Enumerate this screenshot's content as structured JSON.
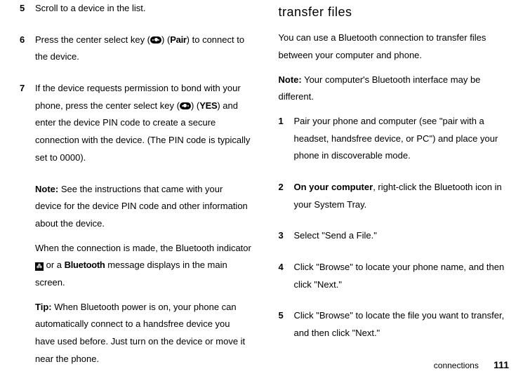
{
  "left": {
    "step5": {
      "num": "5",
      "text": "Scroll to a device in the list."
    },
    "step6": {
      "num": "6",
      "pre": "Press the center select key (",
      "key": "Pair",
      "post": ") to connect to the device."
    },
    "step7": {
      "num": "7",
      "p1a": "If the device requests permission to bond with your phone, press the center select key (",
      "p1key": "YES",
      "p1b": ") and enter the device PIN code to create a secure connection with the device. (The PIN code is typically set to 0000).",
      "noteLabel": "Note:",
      "noteText": " See the instructions that came with your device for the device PIN code and other information about the device.",
      "p2a": "When the connection is made, the Bluetooth indicator ",
      "p2b": " or a ",
      "p2word": "Bluetooth",
      "p2c": " message displays in the main screen.",
      "tipLabel": "Tip:",
      "tipText": " When Bluetooth power is on, your phone can automatically connect to a handsfree device you have used before. Just turn on the device or move it near the phone."
    }
  },
  "right": {
    "heading": "transfer files",
    "intro": "You can use a Bluetooth connection to transfer files between your computer and phone.",
    "noteLabel": "Note:",
    "noteText": " Your computer's Bluetooth interface may be different.",
    "step1": {
      "num": "1",
      "text": "Pair your phone and computer (see \"pair with a headset, handsfree device, or PC\") and place your phone in discoverable mode."
    },
    "step2": {
      "num": "2",
      "bold": "On your computer",
      "rest": ", right-click the Bluetooth icon in your System Tray."
    },
    "step3": {
      "num": "3",
      "text": "Select \"Send a File.\""
    },
    "step4": {
      "num": "4",
      "text": "Click \"Browse\" to locate your phone name, and then click \"Next.\""
    },
    "step5": {
      "num": "5",
      "text": "Click \"Browse\" to locate the file you want to transfer, and then click \"Next.\""
    }
  },
  "footer": {
    "section": "connections",
    "page": "111"
  }
}
